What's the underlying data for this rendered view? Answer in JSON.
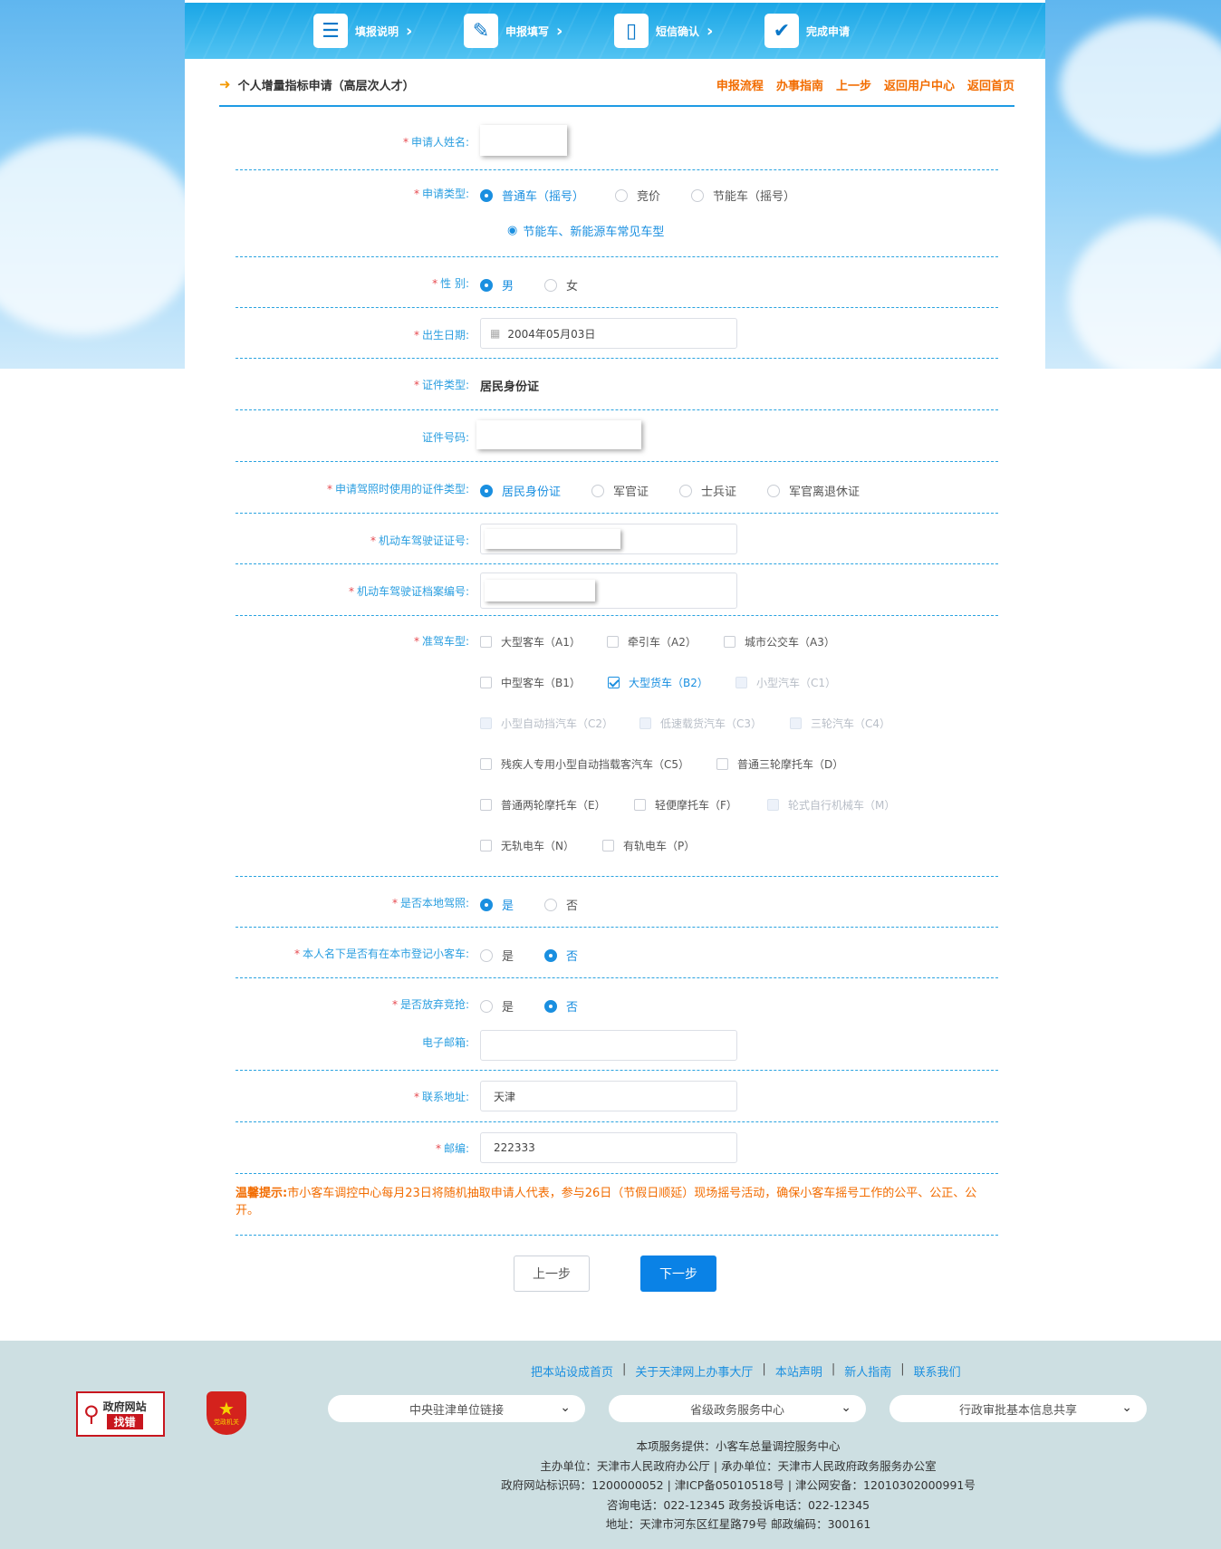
{
  "steps": [
    {
      "label": "填报说明"
    },
    {
      "label": "申报填写"
    },
    {
      "label": "短信确认"
    },
    {
      "label": "完成申请"
    }
  ],
  "header": {
    "title": "个人增量指标申请（高层次人才）",
    "links": [
      "申报流程",
      "办事指南",
      "上一步",
      "返回用户中心",
      "返回首页"
    ]
  },
  "form": {
    "name_label": "申请人姓名:",
    "apply_type_label": "申请类型:",
    "apply_type_options": [
      "普通车（摇号）",
      "竞价",
      "节能车（摇号）"
    ],
    "common_models_link": "节能车、新能源车常见车型",
    "gender_label": "性 别:",
    "gender_options": [
      "男",
      "女"
    ],
    "birth_label": "出生日期:",
    "birth_value": "2004年05月03日",
    "id_type_label": "证件类型:",
    "id_type_value": "居民身份证",
    "id_no_label": "证件号码:",
    "license_id_type_label": "申请驾照时使用的证件类型:",
    "license_id_type_options": [
      "居民身份证",
      "军官证",
      "士兵证",
      "军官离退休证"
    ],
    "license_no_label": "机动车驾驶证证号:",
    "license_file_label": "机动车驾驶证档案编号:",
    "vehicle_class_label": "准驾车型:",
    "vehicle_classes": [
      [
        "大型客车（A1）",
        "牵引车（A2）",
        "城市公交车（A3）"
      ],
      [
        "中型客车（B1）",
        "大型货车（B2）",
        "小型汽车（C1）"
      ],
      [
        "小型自动挡汽车（C2）",
        "低速载货汽车（C3）",
        "三轮汽车（C4）"
      ],
      [
        "残疾人专用小型自动挡载客汽车（C5）",
        "普通三轮摩托车（D）"
      ],
      [
        "普通两轮摩托车（E）",
        "轻便摩托车（F）",
        "轮式自行机械车（M）"
      ],
      [
        "无轨电车（N）",
        "有轨电车（P）"
      ]
    ],
    "local_license_label": "是否本地驾照:",
    "has_car_label": "本人名下是否有在本市登记小客车:",
    "give_up_label": "是否放弃竞抢:",
    "yes": "是",
    "no": "否",
    "email_label": "电子邮箱:",
    "email_value": "",
    "address_label": "联系地址:",
    "address_value": "天津",
    "zip_label": "邮编:",
    "zip_value": "222333",
    "tip_title": "温馨提示:",
    "tip_text": "市小客车调控中心每月23日将随机抽取申请人代表，参与26日（节假日顺延）现场摇号活动，确保小客车摇号工作的公平、公正、公开。",
    "prev_button": "上一步",
    "next_button": "下一步"
  },
  "footer": {
    "links": [
      "把本站设成首页",
      "关于天津网上办事大厅",
      "本站声明",
      "新人指南",
      "联系我们"
    ],
    "badge_error": "政府网站",
    "badge_error_sub": "找错",
    "badge_party": "党政机关",
    "selects": [
      "中央驻津单位链接",
      "省级政务服务中心",
      "行政审批基本信息共享"
    ],
    "info": [
      "本项服务提供：小客车总量调控服务中心",
      "主办单位：天津市人民政府办公厅 | 承办单位：天津市人民政府政务服务办公室",
      "政府网站标识码：1200000052 | 津ICP备05010518号 | 津公网安备：12010302000991号",
      "咨询电话：022-12345 政务投诉电话：022-12345",
      "地址：天津市河东区红星路79号 邮政编码：300161"
    ]
  },
  "colors": {
    "accent": "#1a8fe0",
    "orange": "#f26c00",
    "required": "#e6494f",
    "footer_bg": "#cddfe2"
  }
}
